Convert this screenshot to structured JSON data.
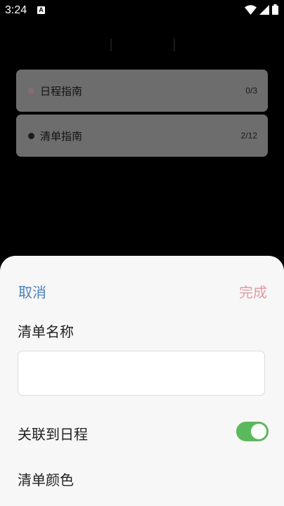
{
  "status_bar": {
    "time": "3:24",
    "notification_icon": "a-badge-icon",
    "icons": [
      "wifi-icon",
      "cell-signal-icon",
      "battery-icon"
    ]
  },
  "background_lists": [
    {
      "label": "日程指南",
      "count": "0/3",
      "dot_color": "#8a6a74"
    },
    {
      "label": "清单指南",
      "count": "2/12",
      "dot_color": "#1c1c1c"
    }
  ],
  "sheet": {
    "cancel_label": "取消",
    "done_label": "完成",
    "name_label": "清单名称",
    "name_value": "",
    "link_label": "关联到日程",
    "link_enabled": true,
    "color_label": "清单颜色"
  },
  "colors": {
    "cancel": "#4a80c0",
    "done": "#e49aa2",
    "toggle_on": "#5cb85c",
    "sheet_bg": "#f7f7f7"
  }
}
